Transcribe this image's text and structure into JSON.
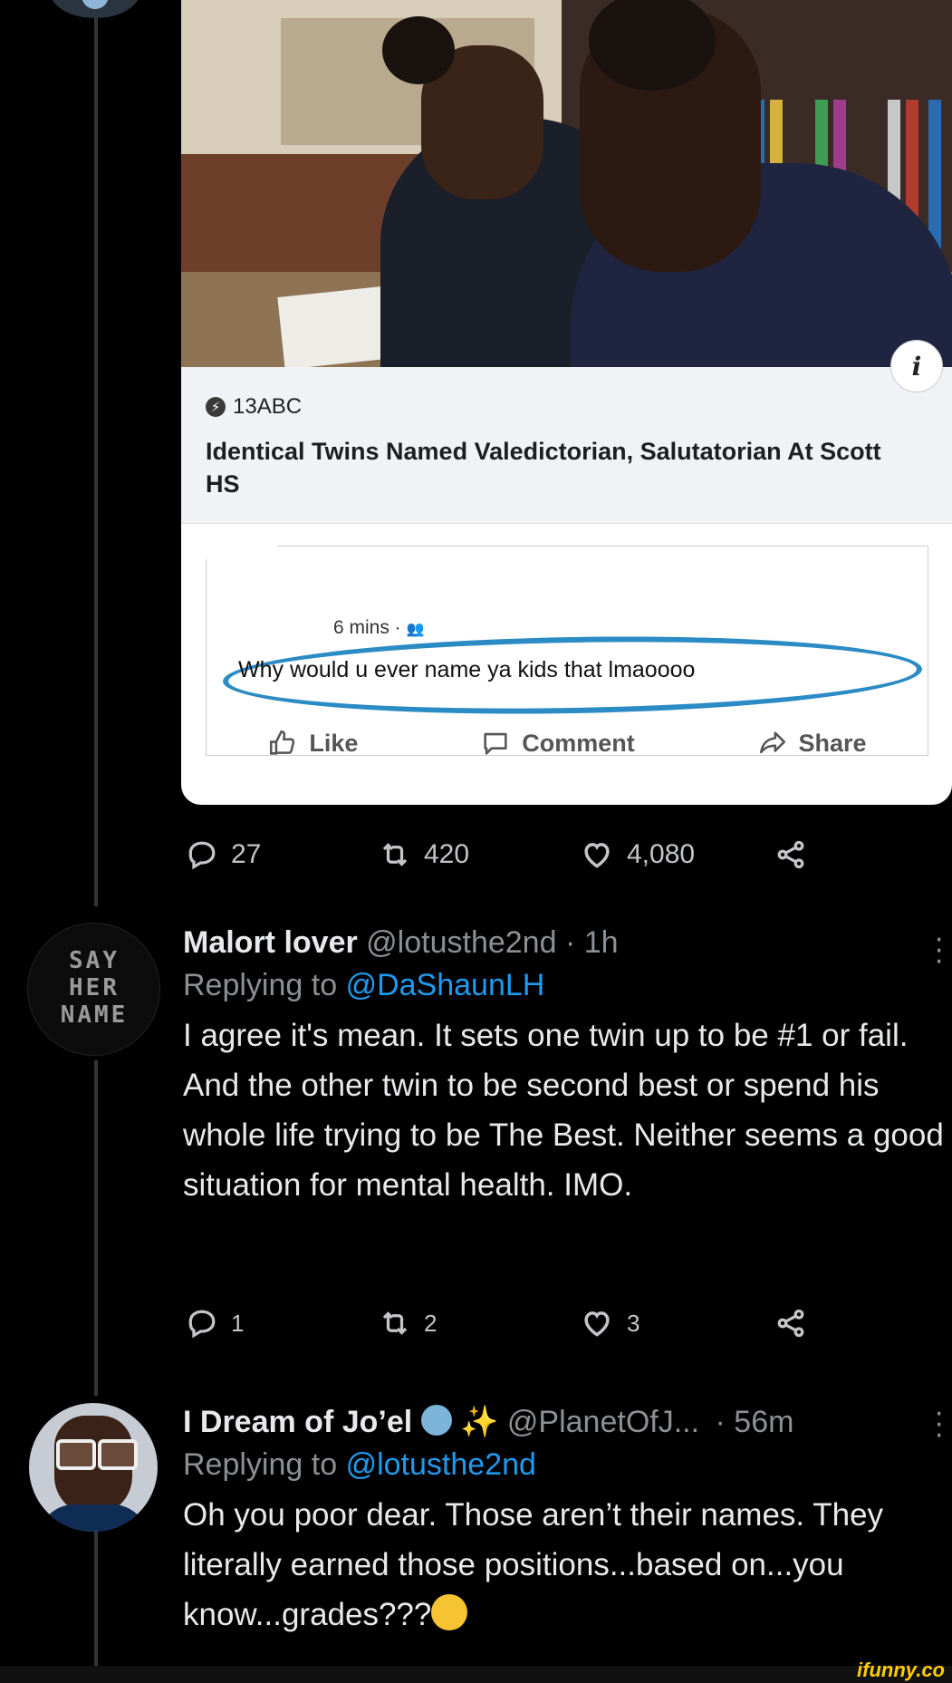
{
  "news_card": {
    "source": "13ABC",
    "headline": "Identical Twins Named Valedictorian, Salutatorian At Scott HS",
    "info_glyph": "i"
  },
  "fb_comment": {
    "time": "6 mins ·",
    "text": "Why would u ever name ya kids that lmaoooo",
    "like_label": "Like",
    "comment_label": "Comment",
    "share_label": "Share",
    "highlight_color": "#2b8bc4"
  },
  "original_tweet": {
    "replies": "27",
    "retweets": "420",
    "likes": "4,080"
  },
  "reply1": {
    "name": "Malort lover",
    "handle": "@lotusthe2nd",
    "time": "· 1h",
    "replying_prefix": "Replying to",
    "replying_to": "@DaShaunLH",
    "text": "I agree it's mean. It sets one twin up to be #1 or fail. And the other twin to be second best or spend his whole life trying to be The Best. Neither seems a good situation for mental health. IMO.",
    "replies": "1",
    "retweets": "2",
    "likes": "3",
    "avatar_text": "SAY HER NAME"
  },
  "reply2": {
    "name": "I Dream of Jo’el",
    "handle": "@PlanetOfJ...",
    "time": "· 56m",
    "replying_prefix": "Replying to",
    "replying_to": "@lotusthe2nd",
    "text": "Oh you poor dear. Those aren’t their names. They literally earned those positions...based on...you know...grades???",
    "emoji_after_name": [
      "genie-emoji",
      "sparkles-emoji"
    ],
    "emoji_after_text": "woozy-face-emoji"
  },
  "watermark": "ifunny.co",
  "colors": {
    "background": "#000000",
    "link": "#1d9bf0",
    "muted": "#8b9095"
  }
}
